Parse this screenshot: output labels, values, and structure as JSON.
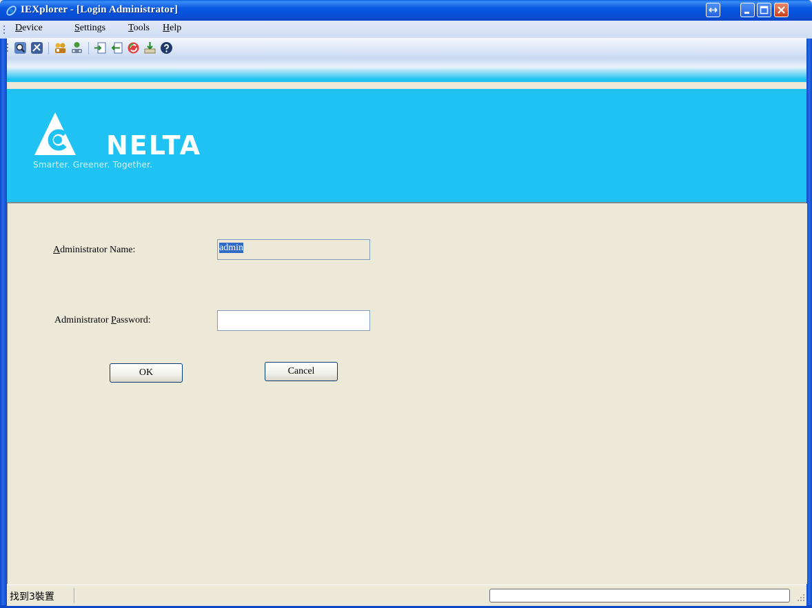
{
  "window": {
    "title": "IEXplorer - [Login Administrator]"
  },
  "menu": {
    "items": [
      {
        "label": "Device",
        "access": "D"
      },
      {
        "label": "Settings",
        "access": "S"
      },
      {
        "label": "Tools",
        "access": "T"
      },
      {
        "label": "Help",
        "access": "H"
      }
    ]
  },
  "toolbar": {
    "icons": [
      "search-device-icon",
      "setup-icon",
      "users-icon",
      "network-icon",
      "import-icon",
      "export-icon",
      "refresh-icon",
      "download-icon",
      "help-icon"
    ]
  },
  "banner": {
    "logo_text": "NELTA",
    "tagline": "Smarter. Greener. Together."
  },
  "form": {
    "name_label_access": "A",
    "name_label_rest": "dministrator Name:",
    "name_value": "admin",
    "password_label_prefix": "Administrator ",
    "password_label_access": "P",
    "password_label_rest": "assword:",
    "password_value": "",
    "ok_label": "OK",
    "cancel_label": "Cancel"
  },
  "status": {
    "text": "找到3裝置"
  },
  "colors": {
    "titlebar": "#0550d8",
    "banner": "#1fc2f2",
    "body": "#ece9d8",
    "selection": "#316ac5"
  }
}
